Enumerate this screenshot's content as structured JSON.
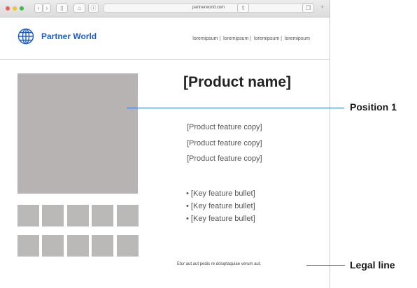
{
  "browser": {
    "url": "partnerworld.com"
  },
  "header": {
    "brand": "Partner World",
    "nav": [
      "loremipsum",
      "loremipsum",
      "loremipsum",
      "loremipsum"
    ]
  },
  "product": {
    "name": "[Product name]",
    "features": [
      "[Product feature copy]",
      "[Product feature copy]",
      "[Product feature copy]"
    ],
    "bullets": [
      "[Key feature bullet]",
      "[Key feature bullet]",
      "[Key feature bullet]"
    ],
    "legal": "Etur aut aut pedis re doluptaquiae verum aut."
  },
  "annotations": {
    "position": "Position 1",
    "legal": "Legal line"
  },
  "colors": {
    "accent": "#1e5fc7",
    "annotation_line": "#2b6fd2",
    "placeholder": "#b7b3b3"
  }
}
